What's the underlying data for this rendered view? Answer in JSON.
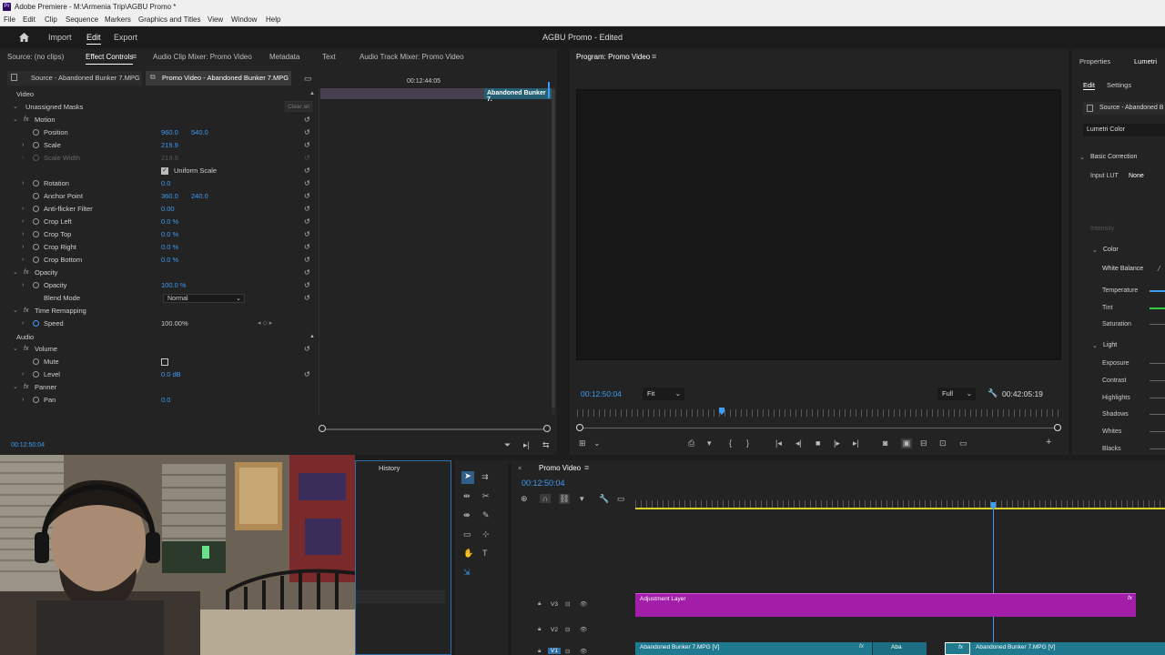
{
  "titlebar": {
    "logo": "Pr",
    "title": "Adobe Premiere - M:\\Armenia Trip\\AGBU Promo *"
  },
  "menubar": {
    "items": [
      "File",
      "Edit",
      "Clip",
      "Sequence",
      "Markers",
      "Graphics and Titles",
      "View",
      "Window",
      "Help"
    ]
  },
  "header": {
    "nav": [
      "Import",
      "Edit",
      "Export"
    ],
    "active": "Edit",
    "project_title": "AGBU Promo - Edited"
  },
  "source_panel": {
    "tabs": [
      "Source: (no clips)",
      "Effect Controls",
      "Audio Clip Mixer: Promo Video",
      "Metadata",
      "Text",
      "Audio Track Mixer: Promo Video"
    ],
    "active_tab": "Effect Controls",
    "subtabs": [
      "Source - Abandoned Bunker 7.MPG",
      "Promo Video - Abandoned Bunker 7.MPG"
    ],
    "timecode_ruler": "00:12:44:05",
    "clip_label": "Abandoned Bunker 7.",
    "video_label": "Video",
    "audio_label": "Audio",
    "clear_all": "Clear all",
    "current_time": "00:12:50:04",
    "rows": {
      "unassigned_masks": "Unassigned Masks",
      "motion": "Motion",
      "position": {
        "label": "Position",
        "v1": "960.0",
        "v2": "540.0"
      },
      "scale": {
        "label": "Scale",
        "v1": "219.9"
      },
      "scale_width": {
        "label": "Scale Width",
        "v1": "219.9"
      },
      "uniform_scale": "Uniform Scale",
      "rotation": {
        "label": "Rotation",
        "v1": "0.0"
      },
      "anchor_point": {
        "label": "Anchor Point",
        "v1": "360.0",
        "v2": "240.0"
      },
      "anti_flicker": {
        "label": "Anti-flicker Filter",
        "v1": "0.00"
      },
      "crop_left": {
        "label": "Crop Left",
        "v1": "0.0 %"
      },
      "crop_top": {
        "label": "Crop Top",
        "v1": "0.0 %"
      },
      "crop_right": {
        "label": "Crop Right",
        "v1": "0.0 %"
      },
      "crop_bottom": {
        "label": "Crop Bottom",
        "v1": "0.0 %"
      },
      "opacity_group": "Opacity",
      "opacity": {
        "label": "Opacity",
        "v1": "100.0 %"
      },
      "blend_mode": {
        "label": "Blend Mode",
        "value": "Normal"
      },
      "time_remapping": "Time Remapping",
      "speed": {
        "label": "Speed",
        "v1": "100.00%"
      },
      "volume": "Volume",
      "mute": {
        "label": "Mute"
      },
      "level": {
        "label": "Level",
        "v1": "0.0 dB"
      },
      "panner": "Panner",
      "pan": {
        "label": "Pan",
        "v1": "0.0"
      }
    }
  },
  "program_panel": {
    "title": "Program: Promo Video",
    "timecode": "00:12:50:04",
    "fit": "Fit",
    "quality": "Full",
    "duration": "00:42:05:19",
    "playhead_fraction": 0.3
  },
  "lumetri": {
    "tabs": [
      "Properties",
      "Lumetri"
    ],
    "subtabs": [
      "Edit",
      "Settings"
    ],
    "source": "Source - Abandoned B",
    "effect": "Lumetri Color",
    "basic_correction": "Basic Correction",
    "input_lut": {
      "label": "Input LUT",
      "value": "None"
    },
    "intensity": "Intensity",
    "color": "Color",
    "white_balance": "White Balance",
    "temperature": "Temperature",
    "tint": "Tint",
    "saturation": "Saturation",
    "light": "Light",
    "exposure": "Exposure",
    "contrast": "Contrast",
    "highlights": "Highlights",
    "shadows": "Shadows",
    "whites": "Whites",
    "blacks": "Blacks"
  },
  "history_panel": {
    "title": "History"
  },
  "timeline": {
    "title": "Promo Video",
    "timecode": "00:12:50:04",
    "tracks": [
      {
        "name": "V3"
      },
      {
        "name": "V2"
      },
      {
        "name": "V1"
      }
    ],
    "clips": {
      "adjustment": "Adjustment Layer",
      "bunker_a": "Abandoned Bunker 7.MPG [V]",
      "bunker_short": "Aba",
      "bunker_b": "Abandoned Bunker 7.MPG [V]"
    },
    "playhead_fraction": 0.676
  },
  "colors": {
    "accent": "#3e9cf2",
    "adjustment_clip": "#a21ea8",
    "video_clip": "#1f7a90",
    "work_area": "#d8d02a"
  }
}
